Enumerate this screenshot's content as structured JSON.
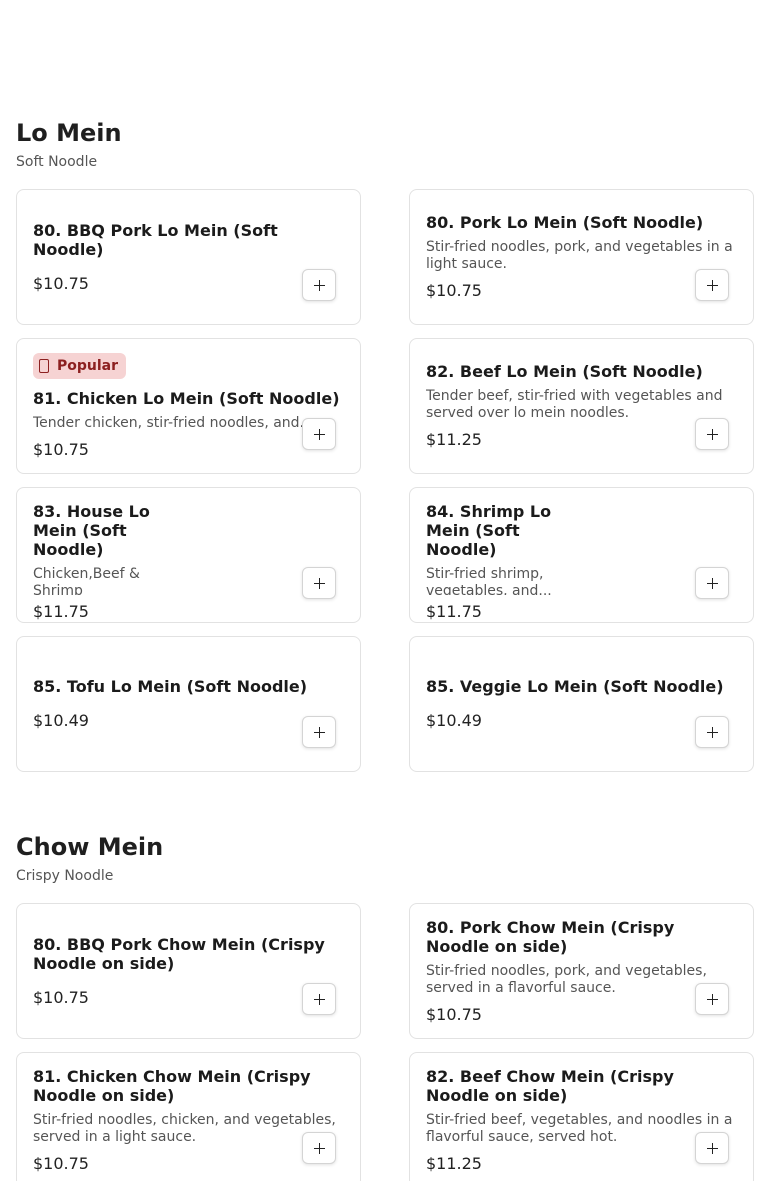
{
  "sections": [
    {
      "title": "Lo Mein",
      "subtitle": "Soft Noodle",
      "items": [
        {
          "name": "80. BBQ Pork Lo Mein (Soft Noodle)",
          "description": "",
          "price": "$10.75",
          "badge": ""
        },
        {
          "name": "80. Pork Lo Mein (Soft Noodle)",
          "description": "Stir-fried noodles, pork, and vegetables in a light sauce.",
          "price": "$10.75",
          "badge": ""
        },
        {
          "name": "81. Chicken Lo Mein (Soft Noodle)",
          "description": "Tender chicken, stir-fried noodles, and...",
          "price": "$10.75",
          "badge": "Popular"
        },
        {
          "name": "82. Beef Lo Mein (Soft Noodle)",
          "description": "Tender beef, stir-fried with vegetables and served over lo mein noodles.",
          "price": "$11.25",
          "badge": ""
        },
        {
          "name": "83. House Lo Mein (Soft Noodle)",
          "description": "Chicken,Beef & Shrimp",
          "price": "$11.75",
          "badge": ""
        },
        {
          "name": "84. Shrimp Lo Mein (Soft Noodle)",
          "description": "Stir-fried shrimp, vegetables, and...",
          "price": "$11.75",
          "badge": ""
        },
        {
          "name": "85. Tofu Lo Mein (Soft Noodle)",
          "description": "",
          "price": "$10.49",
          "badge": ""
        },
        {
          "name": "85. Veggie Lo Mein (Soft Noodle)",
          "description": "",
          "price": "$10.49",
          "badge": ""
        }
      ]
    },
    {
      "title": "Chow Mein",
      "subtitle": "Crispy Noodle",
      "items": [
        {
          "name": "80. BBQ Pork Chow Mein (Crispy Noodle on side)",
          "description": "",
          "price": "$10.75",
          "badge": ""
        },
        {
          "name": "80. Pork Chow Mein (Crispy Noodle on side)",
          "description": "Stir-fried noodles, pork, and vegetables, served in a flavorful sauce.",
          "price": "$10.75",
          "badge": ""
        },
        {
          "name": "81. Chicken Chow Mein (Crispy Noodle on side)",
          "description": "Stir-fried noodles, chicken, and vegetables, served in a light sauce.",
          "price": "$10.75",
          "badge": ""
        },
        {
          "name": "82. Beef Chow Mein (Crispy Noodle on side)",
          "description": "Stir-fried beef, vegetables, and noodles in a flavorful sauce, served hot.",
          "price": "$11.25",
          "badge": ""
        }
      ]
    }
  ],
  "add_button_icon": "plus-icon",
  "badge_icon": "flame-icon"
}
